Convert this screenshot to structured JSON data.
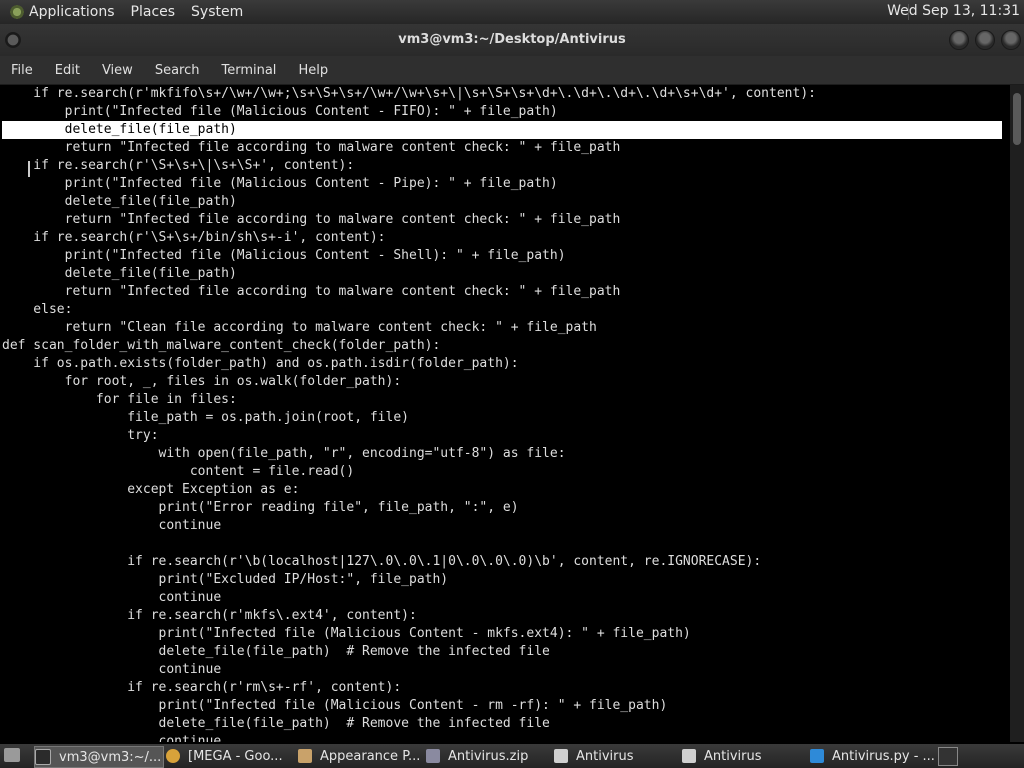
{
  "top_panel": {
    "menus": [
      "Applications",
      "Places",
      "System"
    ],
    "clock": "Wed Sep 13, 11:31"
  },
  "window": {
    "title": "vm3@vm3:~/Desktop/Antivirus"
  },
  "menubar": [
    "File",
    "Edit",
    "View",
    "Search",
    "Terminal",
    "Help"
  ],
  "terminal": {
    "lines": [
      "    if re.search(r'mkfifo\\s+/\\w+/\\w+;\\s+\\S+\\s+/\\w+/\\w+\\s+\\|\\s+\\S+\\s+\\d+\\.\\d+\\.\\d+\\.\\d+\\s+\\d+', content):",
      "        print(\"Infected file (Malicious Content - FIFO): \" + file_path)",
      "        delete_file(file_path)",
      "        return \"Infected file according to malware content check: \" + file_path",
      "    if re.search(r'\\S+\\s+\\|\\s+\\S+', content):",
      "        print(\"Infected file (Malicious Content - Pipe): \" + file_path)",
      "        delete_file(file_path)",
      "        return \"Infected file according to malware content check: \" + file_path",
      "    if re.search(r'\\S+\\s+/bin/sh\\s+-i', content):",
      "        print(\"Infected file (Malicious Content - Shell): \" + file_path)",
      "        delete_file(file_path)",
      "        return \"Infected file according to malware content check: \" + file_path",
      "    else:",
      "        return \"Clean file according to malware content check: \" + file_path",
      "def scan_folder_with_malware_content_check(folder_path):",
      "    if os.path.exists(folder_path) and os.path.isdir(folder_path):",
      "        for root, _, files in os.walk(folder_path):",
      "            for file in files:",
      "                file_path = os.path.join(root, file)",
      "                try:",
      "                    with open(file_path, \"r\", encoding=\"utf-8\") as file:",
      "                        content = file.read()",
      "                except Exception as e:",
      "                    print(\"Error reading file\", file_path, \":\", e)",
      "                    continue",
      "",
      "                if re.search(r'\\b(localhost|127\\.0\\.0\\.1|0\\.0\\.0\\.0)\\b', content, re.IGNORECASE):",
      "                    print(\"Excluded IP/Host:\", file_path)",
      "                    continue",
      "                if re.search(r'mkfs\\.ext4', content):",
      "                    print(\"Infected file (Malicious Content - mkfs.ext4): \" + file_path)",
      "                    delete_file(file_path)  # Remove the infected file",
      "                    continue",
      "                if re.search(r'rm\\s+-rf', content):",
      "                    print(\"Infected file (Malicious Content - rm -rf): \" + file_path)",
      "                    delete_file(file_path)  # Remove the infected file",
      "                    continue"
    ]
  },
  "taskbar": {
    "tasks": [
      {
        "label": "vm3@vm3:~/...",
        "icon": "terminal-icon",
        "active": true
      },
      {
        "label": "[MEGA - Goo...",
        "icon": "chrome-icon",
        "active": false
      },
      {
        "label": "Appearance P...",
        "icon": "appearance-icon",
        "active": false
      },
      {
        "label": "Antivirus.zip",
        "icon": "archive-icon",
        "active": false
      },
      {
        "label": "Antivirus",
        "icon": "folder-icon",
        "active": false
      },
      {
        "label": "Antivirus",
        "icon": "folder-icon",
        "active": false
      },
      {
        "label": "Antivirus.py - ...",
        "icon": "vscode-icon",
        "active": false
      }
    ]
  }
}
